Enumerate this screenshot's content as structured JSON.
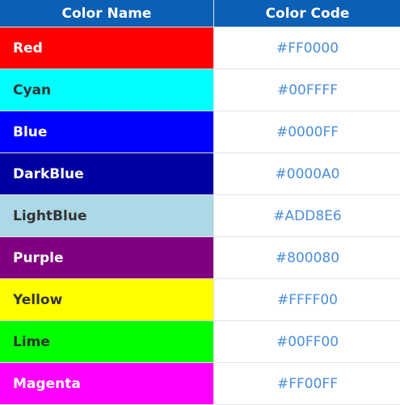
{
  "table": {
    "headers": {
      "name": "Color Name",
      "code": "Color Code"
    },
    "rows": [
      {
        "name": "Red",
        "code": "#FF0000",
        "background": "#FF0000",
        "text_color": "#FFFFFF"
      },
      {
        "name": "Cyan",
        "code": "#00FFFF",
        "background": "#00FFFF",
        "text_color": "#333333"
      },
      {
        "name": "Blue",
        "code": "#0000FF",
        "background": "#0000FF",
        "text_color": "#FFFFFF"
      },
      {
        "name": "DarkBlue",
        "code": "#0000A0",
        "background": "#0000A0",
        "text_color": "#FFFFFF"
      },
      {
        "name": "LightBlue",
        "code": "#ADD8E6",
        "background": "#ADD8E6",
        "text_color": "#333333"
      },
      {
        "name": "Purple",
        "code": "#800080",
        "background": "#800080",
        "text_color": "#FFFFFF"
      },
      {
        "name": "Yellow",
        "code": "#FFFF00",
        "background": "#FFFF00",
        "text_color": "#333333"
      },
      {
        "name": "Lime",
        "code": "#00FF00",
        "background": "#00FF00",
        "text_color": "#333333"
      },
      {
        "name": "Magenta",
        "code": "#FF00FF",
        "background": "#FF00FF",
        "text_color": "#FFFFFF"
      }
    ]
  },
  "colors": {
    "header_background": "#0B5FB5",
    "header_text": "#FFFFFF",
    "code_text": "#4A8ED8",
    "grid_line": "#E4E4E4"
  }
}
